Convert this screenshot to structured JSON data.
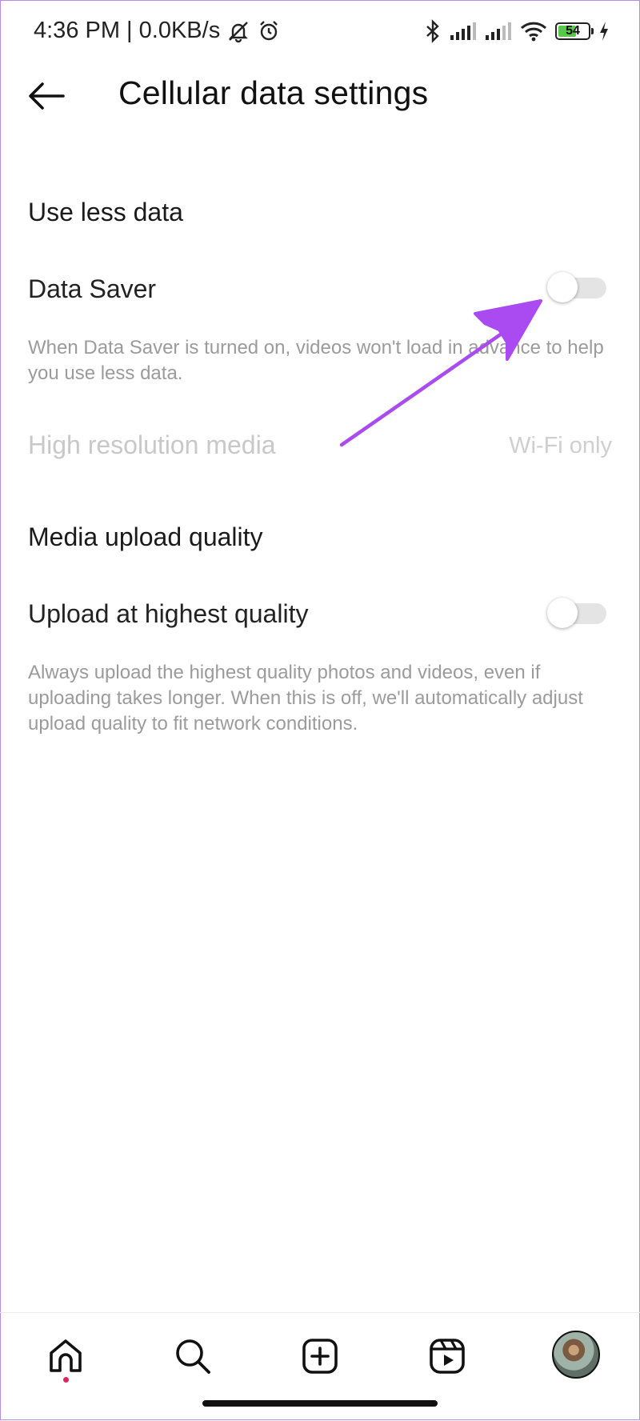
{
  "status_bar": {
    "time_net": "4:36 PM | 0.0KB/s",
    "battery": "54"
  },
  "header": {
    "title": "Cellular data settings"
  },
  "sections": {
    "use_less_data": {
      "title": "Use less data",
      "data_saver": {
        "label": "Data Saver",
        "enabled": false,
        "description": "When Data Saver is turned on, videos won't load in advance to help you use less data."
      },
      "high_res": {
        "label": "High resolution media",
        "value": "Wi-Fi only"
      }
    },
    "media_upload": {
      "title": "Media upload quality",
      "upload_highest": {
        "label": "Upload at highest quality",
        "enabled": false,
        "description": "Always upload the highest quality photos and videos, even if uploading takes longer. When this is off, we'll automatically adjust upload quality to fit network conditions."
      }
    }
  },
  "colors": {
    "annotation_arrow": "#a94bf0",
    "notification_dot": "#e0245e",
    "battery_fill": "#58c84a"
  },
  "icons": {
    "back": "arrow-left-icon",
    "home": "home-icon",
    "search": "search-icon",
    "create": "plus-square-icon",
    "reels": "reels-icon"
  }
}
